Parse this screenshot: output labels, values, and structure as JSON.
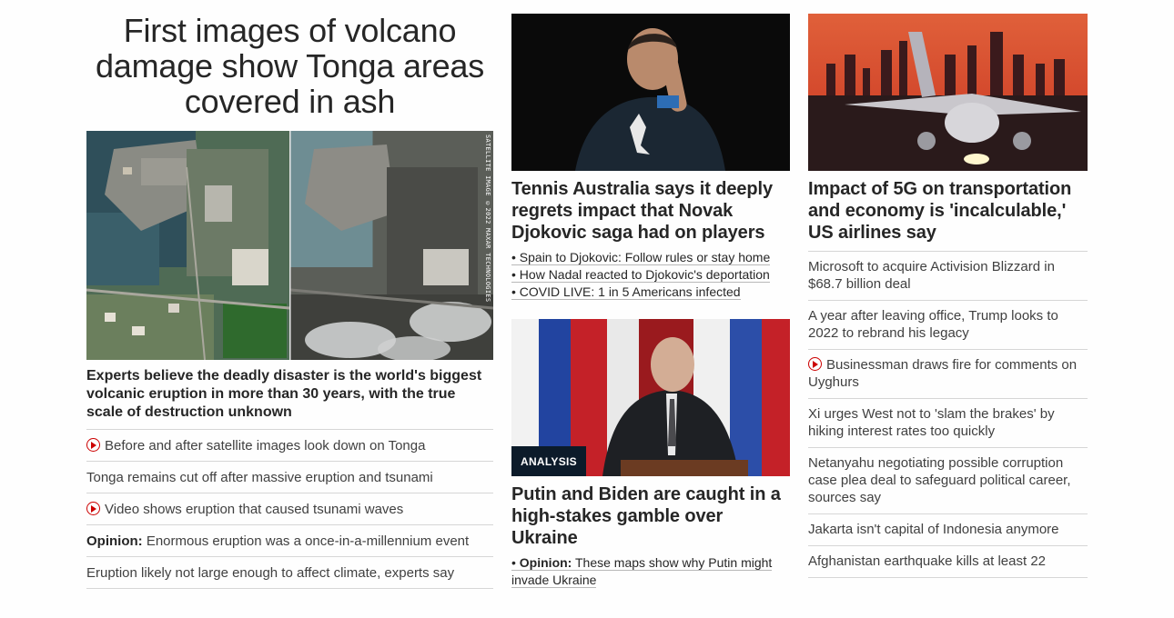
{
  "col1": {
    "title": "First images of volcano damage show Tonga areas covered in ash",
    "image_credit": "SATELLITE IMAGE ©2022 MAXAR TECHNOLOGIES",
    "subhead": "Experts believe the deadly disaster is the world's biggest volcanic eruption in more than 30 years, with the true scale of destruction unknown",
    "links": [
      {
        "text": "Before and after satellite images look down on Tonga",
        "icon": "play-icon"
      },
      {
        "text": "Tonga remains cut off after massive eruption and tsunami"
      },
      {
        "text": "Video shows eruption that caused tsunami waves",
        "icon": "play-icon"
      },
      {
        "prefix": "Opinion:",
        "text": "Enormous eruption was a once-in-a-millennium event"
      },
      {
        "text": "Eruption likely not large enough to affect climate, experts say"
      }
    ]
  },
  "col2": {
    "story1": {
      "title": "Tennis Australia says it deeply regrets impact that Novak Djokovic saga had on players",
      "bullets": [
        "• Spain to Djokovic: Follow rules or stay home",
        "• How Nadal reacted to Djokovic's deportation",
        "• COVID LIVE: 1 in 5 Americans infected"
      ]
    },
    "story2": {
      "badge": "ANALYSIS",
      "title": "Putin and Biden are caught in a high-stakes gamble over Ukraine",
      "bullet_marker": "• ",
      "bullet_prefix": "Opinion:",
      "bullet_text": "These maps show why Putin might invade Ukraine"
    }
  },
  "col3": {
    "title": "Impact of 5G on transportation and economy is 'incalculable,' US airlines say",
    "links": [
      {
        "text": "Microsoft to acquire Activision Blizzard in $68.7 billion deal"
      },
      {
        "text": "A year after leaving office, Trump looks to 2022 to rebrand his legacy"
      },
      {
        "text": "Businessman draws fire for comments on Uyghurs",
        "icon": "play-icon"
      },
      {
        "text": "Xi urges West not to 'slam the brakes' by hiking interest rates too quickly"
      },
      {
        "text": "Netanyahu negotiating possible corruption case plea deal to safeguard political career, sources say"
      },
      {
        "text": "Jakarta isn't capital of Indonesia anymore"
      },
      {
        "text": "Afghanistan earthquake kills at least 22"
      }
    ]
  },
  "colors": {
    "accent_red": "#cc0000",
    "badge_bg": "#0c1b2a",
    "divider": "#d6d6d6"
  }
}
